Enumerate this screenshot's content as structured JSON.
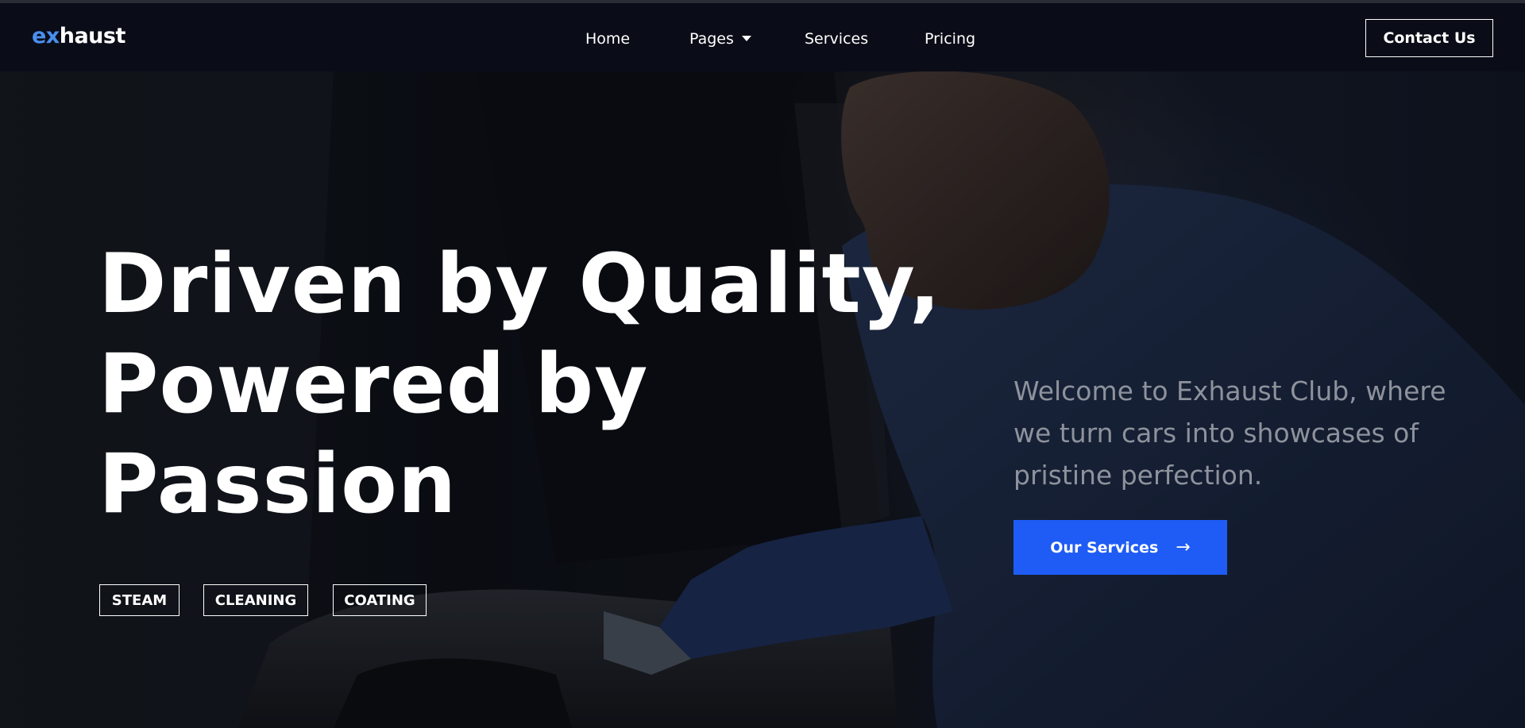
{
  "brand": {
    "logo_prefix": "ex",
    "logo_rest": "haust"
  },
  "nav": {
    "items": [
      {
        "label": "Home"
      },
      {
        "label": "Pages"
      },
      {
        "label": "Services"
      },
      {
        "label": "Pricing"
      }
    ],
    "contact_label": "Contact Us"
  },
  "hero": {
    "headline_lines": [
      "Driven by Quality,",
      "Powered by",
      "Passion"
    ],
    "tags": [
      "STEAM",
      "CLEANING",
      "COATING"
    ],
    "intro": "Welcome to Exhaust Club, where we turn cars into showcases of pristine perfection.",
    "cta_label": "Our Services",
    "cta_icon": "arrow-right-icon",
    "background_image": "man-in-blue-gloves-cleaning-car-interior"
  },
  "colors": {
    "accent": "#1f5cf5",
    "logo_accent": "#4a8ff0",
    "navbar_bg": "#0a0d17",
    "intro_text": "#8d929c"
  }
}
